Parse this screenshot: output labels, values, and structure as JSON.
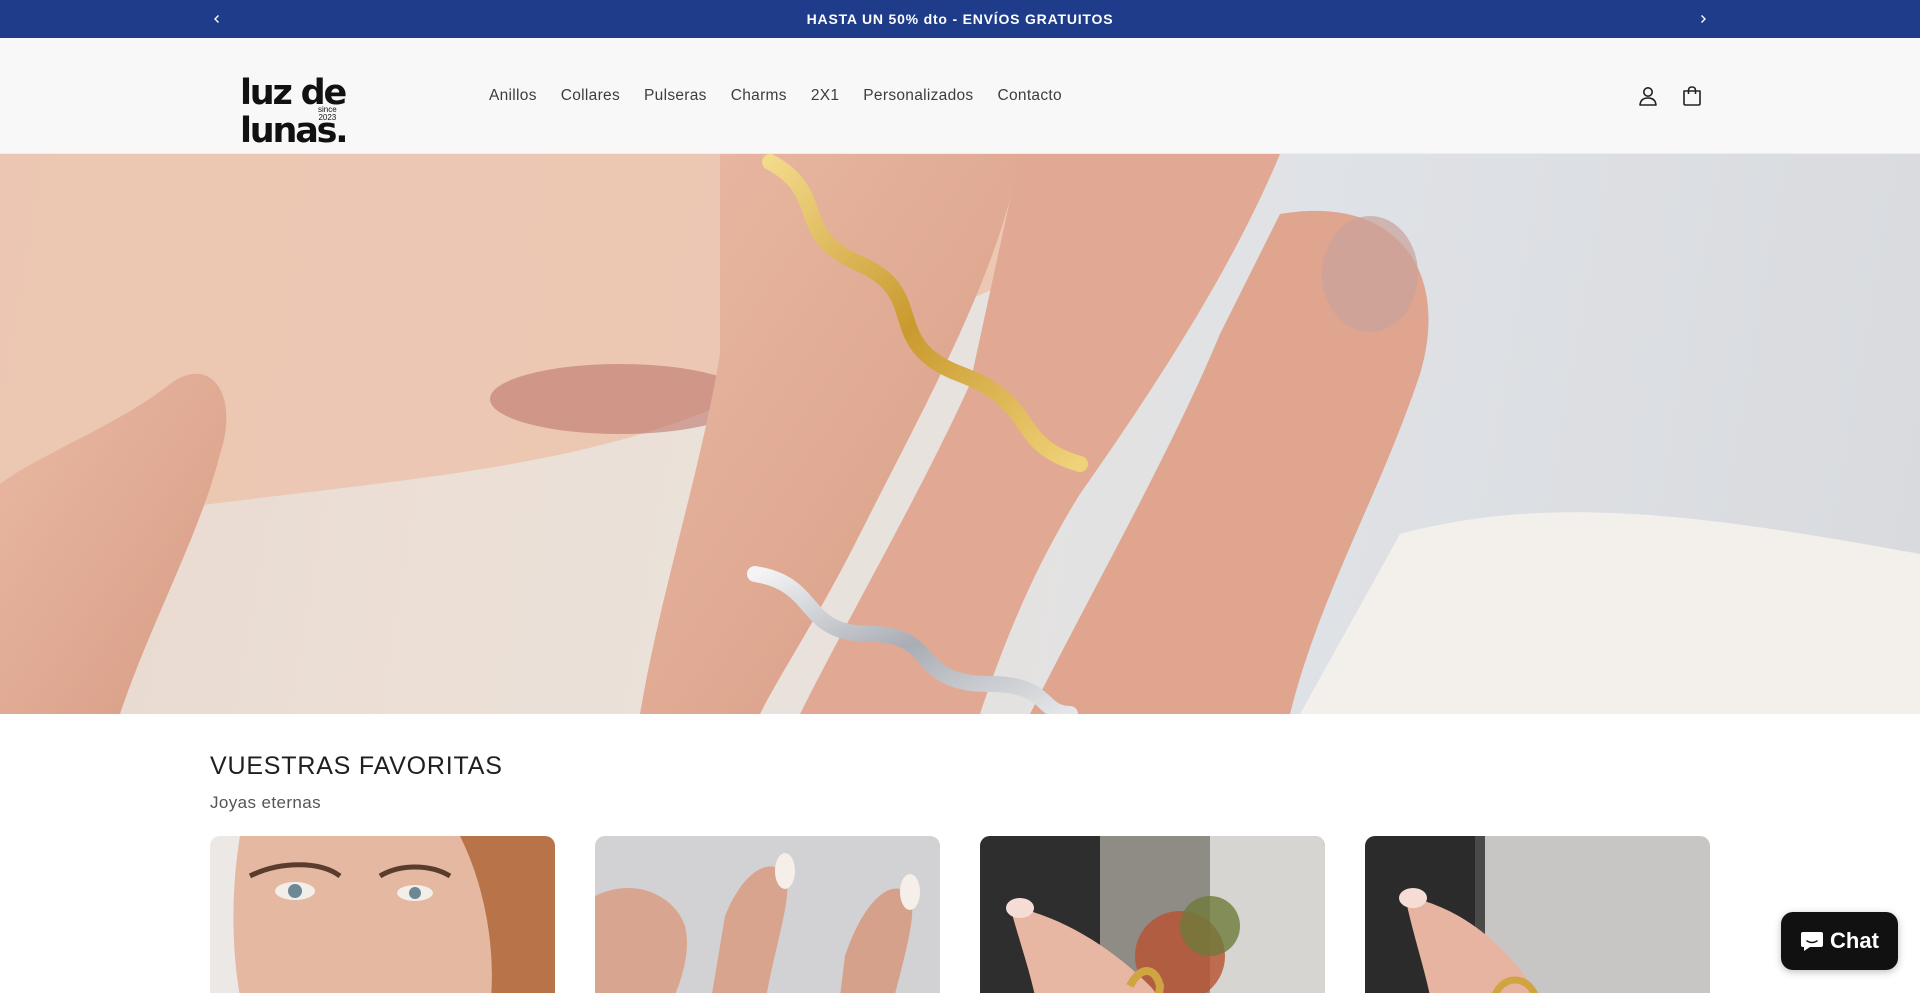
{
  "announcement": {
    "message": "HASTA UN 50% dto - ENVÍOS GRATUITOS",
    "prev_icon": "chevron-left-icon",
    "next_icon": "chevron-right-icon"
  },
  "header": {
    "logo_text": "luz de lunas.",
    "logo_since_line1": "since",
    "logo_since_line2": "2023",
    "nav": [
      "Anillos",
      "Collares",
      "Pulseras",
      "Charms",
      "2X1",
      "Personalizados",
      "Contacto"
    ],
    "account_icon": "user-icon",
    "cart_icon": "cart-icon"
  },
  "hero": {
    "image": "hand-with-gold-and-silver-wave-rings"
  },
  "favorites": {
    "title": "VUESTRAS FAVORITAS",
    "subtitle": "Joyas eternas",
    "cards": [
      {
        "image": "woman-portrait-earrings"
      },
      {
        "image": "manicured-hands-rings"
      },
      {
        "image": "finger-with-gold-ring-outdoor"
      },
      {
        "image": "finger-with-gold-ring-window"
      }
    ]
  },
  "chat": {
    "label": "Chat",
    "icon": "chat-bubble-icon"
  },
  "colors": {
    "announcement_bg": "#1f3c8a",
    "header_bg": "#f8f8f8",
    "chat_bg": "#111111"
  }
}
